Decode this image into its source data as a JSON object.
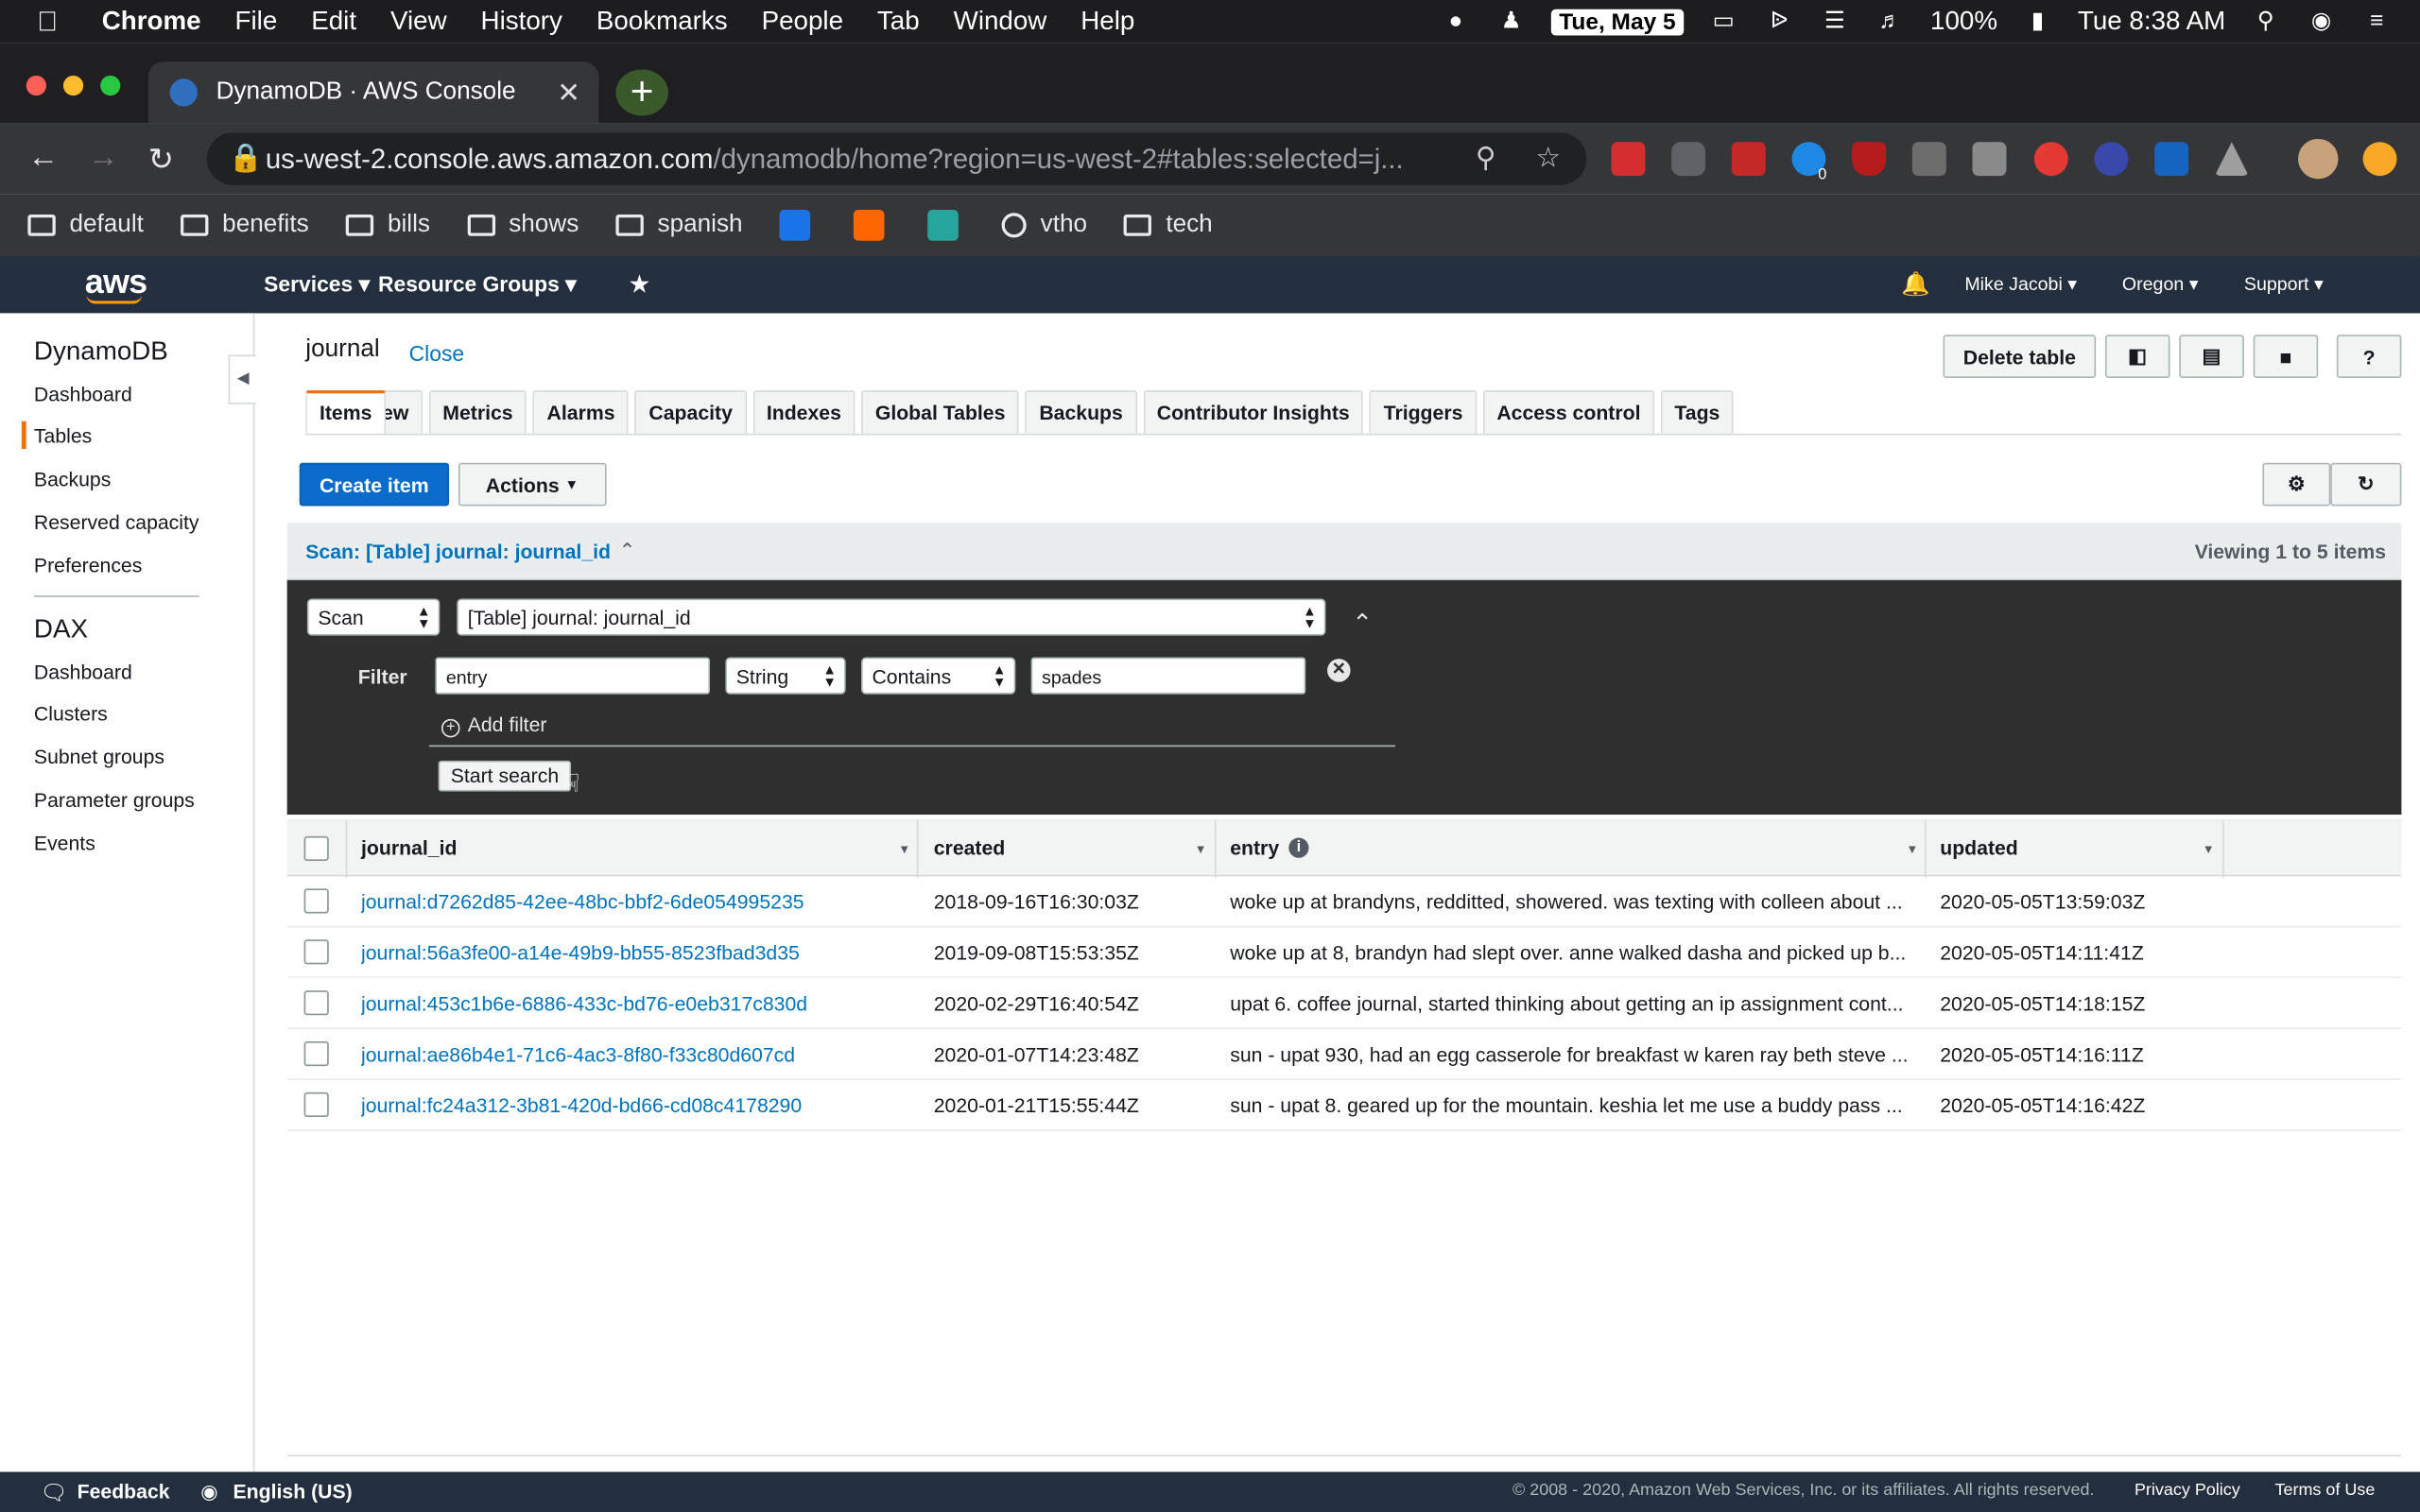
{
  "menubar": {
    "app": "Chrome",
    "menus": [
      "File",
      "Edit",
      "View",
      "History",
      "Bookmarks",
      "People",
      "Tab",
      "Window",
      "Help"
    ],
    "date": "Tue, May 5",
    "battery": "100%",
    "clock": "Tue 8:38 AM"
  },
  "browser": {
    "tab_title": "DynamoDB · AWS Console",
    "url_host": "us-west-2.console.aws.amazon.com",
    "url_path": "/dynamodb/home?region=us-west-2#tables:selected=j...",
    "extension_badge": "0",
    "bookmarks": [
      "default",
      "benefits",
      "bills",
      "shows",
      "spanish",
      "vtho",
      "tech"
    ]
  },
  "aws_nav": {
    "logo": "aws",
    "services": "Services",
    "resource_groups": "Resource Groups",
    "user": "Mike Jacobi",
    "region": "Oregon",
    "support": "Support"
  },
  "sidebar": {
    "dynamo_title": "DynamoDB",
    "dynamo_items": [
      "Dashboard",
      "Tables",
      "Backups",
      "Reserved capacity",
      "Preferences"
    ],
    "dax_title": "DAX",
    "dax_items": [
      "Dashboard",
      "Clusters",
      "Subnet groups",
      "Parameter groups",
      "Events"
    ]
  },
  "main": {
    "table_name": "journal",
    "close": "Close",
    "delete_table": "Delete table",
    "tabs": [
      "Overview",
      "Items",
      "Metrics",
      "Alarms",
      "Capacity",
      "Indexes",
      "Global Tables",
      "Backups",
      "Contributor Insights",
      "Triggers",
      "Access control",
      "Tags"
    ],
    "create_item": "Create item",
    "actions": "Actions"
  },
  "scan": {
    "header": "Scan: [Table] journal: journal_id",
    "viewing": "Viewing 1 to 5 items",
    "mode": "Scan",
    "target": "[Table] journal: journal_id",
    "filter_label": "Filter",
    "filter_attr": "entry",
    "filter_type": "String",
    "filter_op": "Contains",
    "filter_value": "spades",
    "add_filter": "Add filter",
    "start_search": "Start search"
  },
  "items_table": {
    "columns": [
      "journal_id",
      "created",
      "entry",
      "updated"
    ],
    "rows": [
      [
        "journal:d7262d85-42ee-48bc-bbf2-6de054995235",
        "2018-09-16T16:30:03Z",
        "woke up at brandyns, redditted, showered. was texting with colleen about ...",
        "2020-05-05T13:59:03Z"
      ],
      [
        "journal:56a3fe00-a14e-49b9-bb55-8523fbad3d35",
        "2019-09-08T15:53:35Z",
        "woke up at 8, brandyn had slept over. anne walked dasha and picked up b...",
        "2020-05-05T14:11:41Z"
      ],
      [
        "journal:453c1b6e-6886-433c-bd76-e0eb317c830d",
        "2020-02-29T16:40:54Z",
        "upat 6. coffee journal, started thinking about getting an ip assignment cont...",
        "2020-05-05T14:18:15Z"
      ],
      [
        "journal:ae86b4e1-71c6-4ac3-8f80-f33c80d607cd",
        "2020-01-07T14:23:48Z",
        "sun - upat 930, had an egg casserole for breakfast w karen ray beth steve ...",
        "2020-05-05T14:16:11Z"
      ],
      [
        "journal:fc24a312-3b81-420d-bd66-cd08c4178290",
        "2020-01-21T15:55:44Z",
        "sun - upat 8. geared up for the mountain. keshia let me use a buddy pass ...",
        "2020-05-05T14:16:42Z"
      ]
    ]
  },
  "footer": {
    "feedback": "Feedback",
    "language": "English (US)",
    "copyright": "© 2008 - 2020, Amazon Web Services, Inc. or its affiliates. All rights reserved.",
    "privacy": "Privacy Policy",
    "terms": "Terms of Use"
  }
}
